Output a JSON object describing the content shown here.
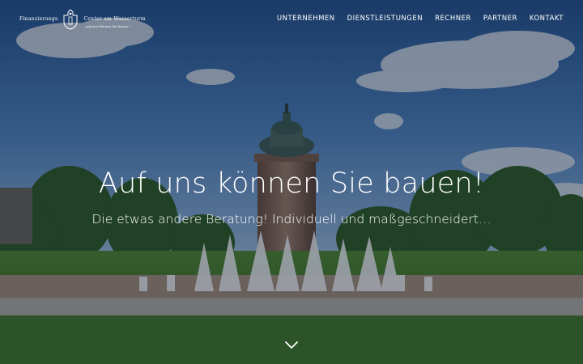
{
  "logo": {
    "name_left": "Finanzierungs",
    "name_right": "Center am Wasserturm",
    "tagline": "…auf uns können Sie bauen !"
  },
  "nav": {
    "items": [
      {
        "label": "UNTERNEHMEN"
      },
      {
        "label": "DIENSTLEISTUNGEN"
      },
      {
        "label": "RECHNER"
      },
      {
        "label": "PARTNER"
      },
      {
        "label": "KONTAKT"
      }
    ]
  },
  "hero": {
    "headline": "Auf uns können Sie bauen!",
    "subheadline": "Die etwas andere Beratung! Individuell und maßgeschneidert…",
    "scroll_icon": "chevron-down-icon"
  },
  "colors": {
    "text": "#ffffff",
    "sky": "#3b6aa8",
    "lawn": "#2e5a1e"
  }
}
